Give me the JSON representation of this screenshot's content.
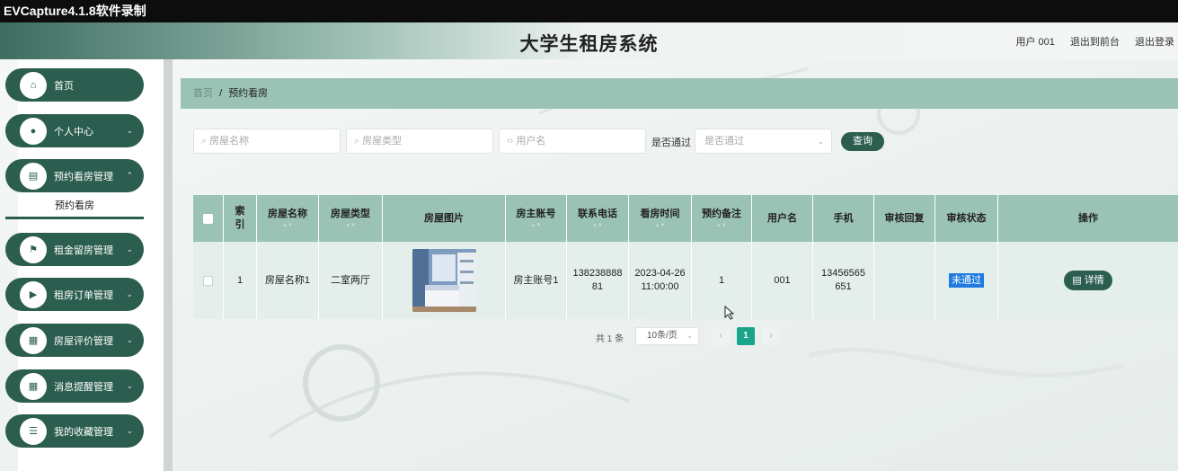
{
  "capture_bar": {
    "title": "EVCapture4.1.8软件录制"
  },
  "header": {
    "title": "大学生租房系统",
    "links": [
      "用户 001",
      "退出到前台",
      "退出登录"
    ]
  },
  "sidebar": {
    "items": [
      {
        "label": "首页",
        "icon": "home-icon",
        "has_chevron": false
      },
      {
        "label": "个人中心",
        "icon": "user-icon",
        "has_chevron": true
      },
      {
        "label": "预约看房管理",
        "icon": "clipboard-icon",
        "has_chevron": true
      },
      {
        "label": "租金留房管理",
        "icon": "flag-icon",
        "has_chevron": true
      },
      {
        "label": "租房订单管理",
        "icon": "video-icon",
        "has_chevron": true
      },
      {
        "label": "房屋评价管理",
        "icon": "grid-icon",
        "has_chevron": true
      },
      {
        "label": "消息提醒管理",
        "icon": "grid-icon",
        "has_chevron": true
      },
      {
        "label": "我的收藏管理",
        "icon": "list-icon",
        "has_chevron": true
      }
    ],
    "active_sub": "预约看房"
  },
  "breadcrumb": {
    "home": "首页",
    "separator": "/",
    "current": "预约看房"
  },
  "search": {
    "house_name_placeholder": "房屋名称",
    "house_type_placeholder": "房屋类型",
    "username_placeholder": "用户名",
    "approved_label": "是否通过",
    "approved_placeholder": "是否通过",
    "query_button": "查询"
  },
  "table": {
    "headers": [
      "索引",
      "房屋名称",
      "房屋类型",
      "房屋图片",
      "房主账号",
      "联系电话",
      "看房时间",
      "预约备注",
      "用户名",
      "手机",
      "审核回复",
      "审核状态",
      "操作"
    ],
    "rows": [
      {
        "index": "1",
        "house_name": "房屋名称1",
        "house_type": "二室两厅",
        "owner_account": "房主账号1",
        "phone": "13823888881",
        "view_time": "2023-04-26 11:00:00",
        "remark": "1",
        "username": "001",
        "mobile": "13456565651",
        "reply": "",
        "status": "未通过",
        "action": "详情"
      }
    ]
  },
  "pagination": {
    "total": "共 1 条",
    "page_size": "10条/页",
    "prev": "‹",
    "current": "1",
    "next": "›"
  },
  "colors": {
    "primary": "#2c5e50",
    "table_header": "#9ac2b5",
    "page_active": "#18a58a",
    "status_bg": "#1f7be0"
  }
}
